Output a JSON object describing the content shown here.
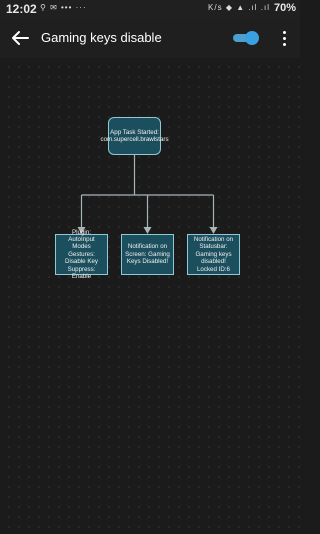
{
  "status_bar": {
    "time": "12:02",
    "left_icons": "⚲ ✉ ••• ···",
    "right_icons": "K/s ◆ ▲ .ıl .ıl",
    "battery": "70%"
  },
  "app_bar": {
    "title": "Gaming keys disable",
    "back_icon": "arrow-left-icon",
    "enabled": true,
    "menu_icon": "more-vert-icon"
  },
  "flow": {
    "root": {
      "label": "App Task Started: com.supercell.brawlstars"
    },
    "children": [
      {
        "label": "Plugin: AutoInput Modes Gestures: Disable Key Suppress: Enable"
      },
      {
        "label": "Notification on Screen: Gaming Keys Disabled!"
      },
      {
        "label": "Notification on Statusbar: Gaming keys disabled! Locked ID:6"
      }
    ]
  },
  "colors": {
    "node_fill": "#1c4f5e",
    "node_border": "#8fc9d8",
    "connector": "#a9b4b8",
    "toggle_accent": "#3aa0e0"
  }
}
